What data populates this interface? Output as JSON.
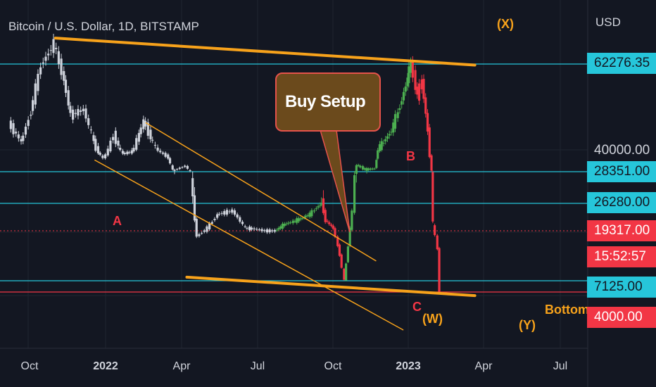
{
  "header": {
    "title": "Bitcoin / U.S. Dollar, 1D, BITSTAMP",
    "currency": "USD"
  },
  "callout": {
    "text": "Buy Setup"
  },
  "wave_labels": {
    "a": "A",
    "b": "B",
    "c": "C",
    "w": "(W)",
    "x": "(X)",
    "y": "(Y)",
    "bottom": "Bottom"
  },
  "price_labels": {
    "p62276": "62276.35",
    "p40000": "40000.00",
    "p28351": "28351.00",
    "p26280": "26280.00",
    "p19317": "19317.00",
    "countdown": "15:52:57",
    "p7125": "7125.00",
    "p4000": "4000.00"
  },
  "colors": {
    "background": "#131722",
    "grid": "#1f2430",
    "candles_history": "#cfd3dc",
    "projection_up": "#4caf50",
    "projection_down": "#f23645",
    "trendline": "#f7a21b",
    "hline_cyan": "#26c6da",
    "hline_red": "#f23645",
    "text": "#d1d4dc"
  },
  "chart_data": {
    "type": "line",
    "title": "Bitcoin / U.S. Dollar, 1D, BITSTAMP",
    "y_unit": "USD",
    "x_ticks": [
      "Oct",
      "2022",
      "Apr",
      "Jul",
      "Oct",
      "2023",
      "Apr",
      "Jul"
    ],
    "y_tick_labels": [
      "40000.00"
    ],
    "horizontal_levels": [
      62276.35,
      28351.0,
      26280.0,
      19317.0,
      7125.0,
      4000.0
    ],
    "last_price": 19317.0,
    "countdown": "15:52:57",
    "series": [
      {
        "role": "history",
        "points": [
          [
            "2021-09-01",
            47000
          ],
          [
            "2021-09-20",
            42000
          ],
          [
            "2021-10-05",
            50000
          ],
          [
            "2021-10-20",
            62000
          ],
          [
            "2021-11-10",
            67500
          ],
          [
            "2021-11-25",
            58000
          ],
          [
            "2021-12-05",
            49000
          ],
          [
            "2021-12-25",
            50500
          ],
          [
            "2022-01-10",
            42000
          ],
          [
            "2022-01-24",
            35500
          ],
          [
            "2022-02-10",
            44000
          ],
          [
            "2022-02-24",
            38000
          ],
          [
            "2022-03-10",
            39000
          ],
          [
            "2022-03-28",
            47500
          ],
          [
            "2022-04-15",
            40500
          ],
          [
            "2022-05-05",
            36000
          ],
          [
            "2022-05-12",
            28800
          ],
          [
            "2022-05-31",
            31500
          ],
          [
            "2022-06-12",
            26500
          ],
          [
            "2022-06-18",
            18000
          ],
          [
            "2022-07-05",
            20000
          ],
          [
            "2022-07-20",
            23500
          ],
          [
            "2022-08-12",
            24400
          ],
          [
            "2022-09-01",
            20000
          ],
          [
            "2022-09-15",
            19800
          ],
          [
            "2022-10-01",
            19300
          ],
          [
            "2022-10-17",
            19317
          ]
        ]
      },
      {
        "role": "projection-up-1",
        "points": [
          [
            "2022-10-17",
            19317
          ],
          [
            "2022-11-01",
            21000
          ],
          [
            "2022-11-20",
            22000
          ],
          [
            "2022-12-10",
            23500
          ],
          [
            "2022-12-20",
            25200
          ],
          [
            "2022-12-28",
            26280
          ]
        ]
      },
      {
        "role": "projection-down-1",
        "points": [
          [
            "2022-12-28",
            26280
          ],
          [
            "2023-01-03",
            22000
          ],
          [
            "2023-01-15",
            20000
          ],
          [
            "2023-01-25",
            13500
          ],
          [
            "2023-02-01",
            7125
          ]
        ]
      },
      {
        "role": "projection-up-2",
        "points": [
          [
            "2023-02-01",
            7125
          ],
          [
            "2023-02-10",
            20000
          ],
          [
            "2023-02-20",
            32000
          ],
          [
            "2023-03-05",
            29500
          ],
          [
            "2023-03-20",
            30000
          ],
          [
            "2023-03-25",
            40000
          ],
          [
            "2023-04-15",
            45000
          ],
          [
            "2023-05-01",
            53000
          ],
          [
            "2023-05-15",
            62276.35
          ]
        ]
      },
      {
        "role": "projection-down-2",
        "points": [
          [
            "2023-05-15",
            62276.35
          ],
          [
            "2023-05-25",
            54000
          ],
          [
            "2023-06-01",
            58000
          ],
          [
            "2023-06-10",
            45000
          ],
          [
            "2023-06-18",
            21000
          ],
          [
            "2023-06-25",
            15000
          ],
          [
            "2023-06-28",
            4000
          ]
        ]
      }
    ],
    "trendlines": [
      {
        "name": "upper-resistance",
        "from": [
          "2021-11-10",
          69000
        ],
        "to": [
          "2023-08-20",
          62000
        ]
      },
      {
        "name": "lower-support",
        "from": [
          "2022-06-01",
          8000
        ],
        "to": [
          "2023-08-20",
          3000
        ]
      },
      {
        "name": "channel-top",
        "from": [
          "2022-03-30",
          47000
        ],
        "to": [
          "2023-03-20",
          12000
        ]
      },
      {
        "name": "channel-bottom",
        "from": [
          "2022-01-10",
          34500
        ],
        "to": [
          "2023-05-01",
          -6500
        ]
      }
    ]
  }
}
